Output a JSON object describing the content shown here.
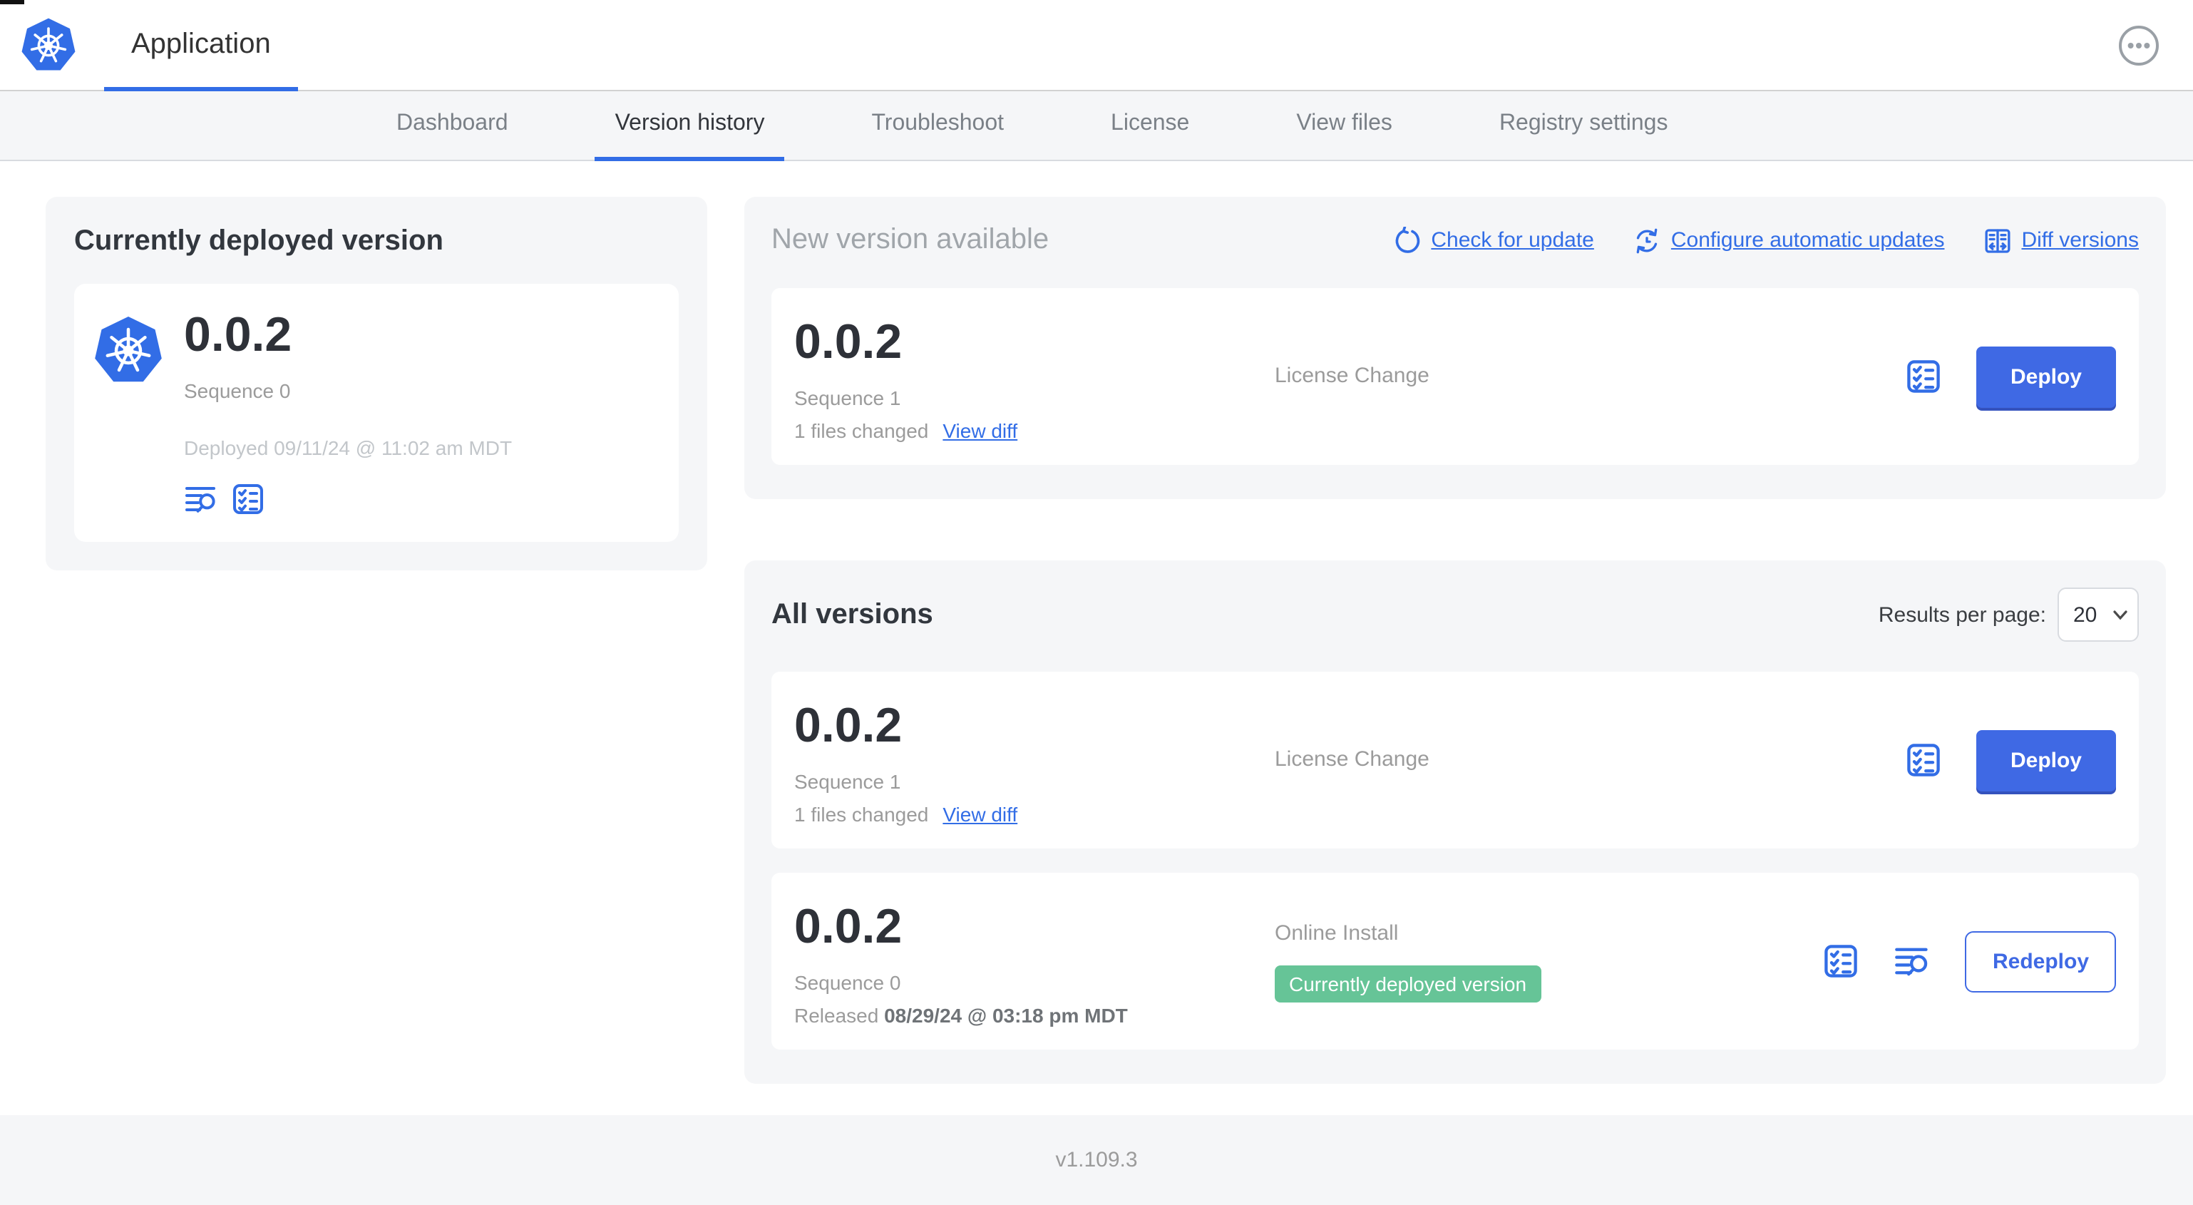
{
  "app": {
    "title": "Application"
  },
  "nav": {
    "tabs": [
      "Dashboard",
      "Version history",
      "Troubleshoot",
      "License",
      "View files",
      "Registry settings"
    ],
    "active_tab": "Version history"
  },
  "current_version": {
    "title": "Currently deployed version",
    "version": "0.0.2",
    "sequence": "Sequence 0",
    "deployed": "Deployed 09/11/24 @ 11:02 am MDT"
  },
  "new_version": {
    "title": "New version available",
    "actions": {
      "check_for_update": "Check for update",
      "configure_automatic_updates": "Configure automatic updates",
      "diff_versions": "Diff versions"
    },
    "card": {
      "version": "0.0.2",
      "sequence": "Sequence 1",
      "files_changed": "1 files changed",
      "view_diff": "View diff",
      "source": "License Change",
      "action": "Deploy"
    }
  },
  "all_versions": {
    "title": "All versions",
    "results_per_page_label": "Results per page:",
    "results_per_page_value": "20",
    "rows": [
      {
        "version": "0.0.2",
        "sequence": "Sequence 1",
        "files_changed": "1 files changed",
        "view_diff": "View diff",
        "source": "License Change",
        "action": "Deploy"
      },
      {
        "version": "0.0.2",
        "sequence": "Sequence 0",
        "released_prefix": "Released",
        "released_date": "08/29/24 @ 03:18 pm MDT",
        "source": "Online Install",
        "badge": "Currently deployed version",
        "action": "Redeploy"
      }
    ]
  },
  "footer": {
    "console_version": "v1.109.3"
  },
  "icons": {
    "app_logo": "kubernetes-wheel",
    "header_menu": "ellipsis",
    "check_for_update": "refresh-arrow",
    "configure_automatic_updates": "auto-update-clock",
    "diff_versions": "split-diff",
    "preflight": "checklist",
    "logs": "log-search",
    "select": "chevron-down"
  },
  "colors": {
    "link_blue": "#326de6",
    "button_blue": "#3f69e4",
    "badge_green": "#66c497",
    "section_bg": "#f5f6f8"
  }
}
